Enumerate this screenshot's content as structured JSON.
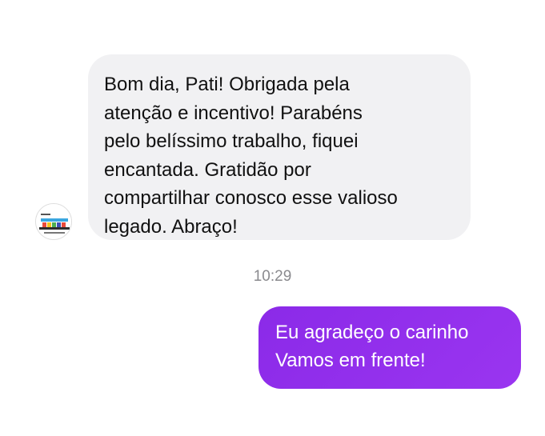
{
  "conversation": {
    "incoming": {
      "lines": [
        "Bom dia, Pati! Obrigada pela",
        "atenção e incentivo! Parabéns",
        "pelo belíssimo trabalho, fiquei",
        "encantada. Gratidão por",
        "compartilhar conosco esse valioso",
        "legado. Abraço!"
      ],
      "avatar_icon": "profile-logo-icon",
      "bubble_color": "#f1f1f3"
    },
    "timestamp": "10:29",
    "outgoing": {
      "lines": [
        "Eu agradeço o carinho",
        "Vamos em frente!"
      ],
      "bubble_color": "#8b2ae8"
    }
  }
}
